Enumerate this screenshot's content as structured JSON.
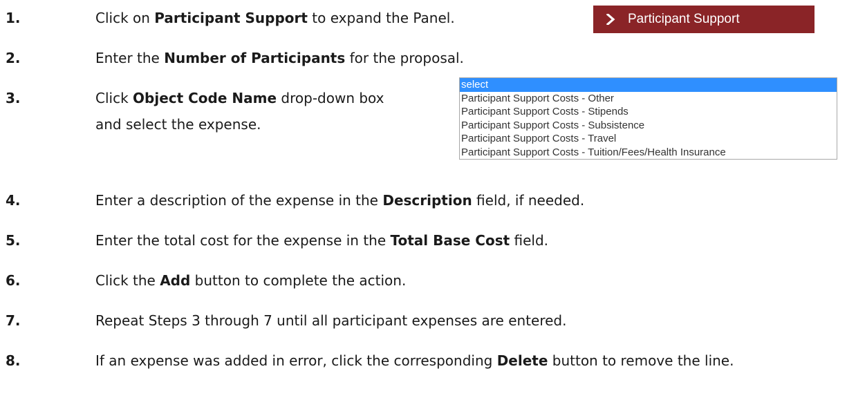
{
  "panel_button": {
    "label": "Participant Support",
    "icon": "chevron-right-icon",
    "color": "#8a2427"
  },
  "dropdown": {
    "options": [
      "select",
      "Participant Support Costs - Other",
      "Participant Support Costs - Stipends",
      "Participant Support Costs - Subsistence",
      "Participant Support Costs - Travel",
      "Participant Support Costs - Tuition/Fees/Health Insurance"
    ],
    "selected": "select",
    "highlight_color": "#2f8fff"
  },
  "steps": [
    {
      "num": "1.",
      "pre": "Click on ",
      "bold": "Participant Support",
      "post": " to expand the Panel."
    },
    {
      "num": "2.",
      "pre": "Enter the ",
      "bold": "Number of Participants",
      "post": " for the proposal."
    },
    {
      "num": "3.",
      "pre": "Click ",
      "bold": "Object Code Name",
      "post": " drop-down box",
      "line2": "and select the expense."
    },
    {
      "num": "4.",
      "pre": "Enter a description of the expense in the ",
      "bold": "Description",
      "post": " field, if needed."
    },
    {
      "num": "5.",
      "pre": "Enter the total cost for the expense in the ",
      "bold": "Total Base Cost",
      "post": " field."
    },
    {
      "num": "6.",
      "pre": "Click the ",
      "bold": "Add",
      "post": " button to complete the action."
    },
    {
      "num": "7.",
      "pre": "Repeat Steps 3 through 7 until all participant expenses are entered.",
      "bold": "",
      "post": ""
    },
    {
      "num": "8.",
      "pre": "If an expense was added in error, click the corresponding ",
      "bold": "Delete",
      "post": " button to remove the line."
    }
  ]
}
